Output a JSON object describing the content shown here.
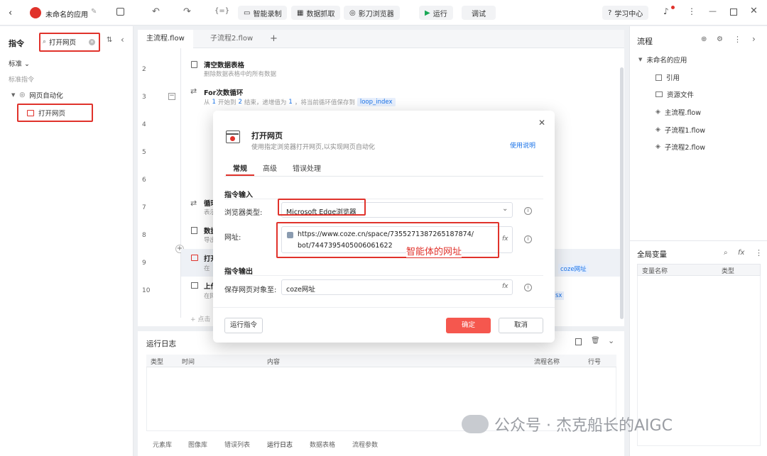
{
  "app": {
    "title": "未命名的应用"
  },
  "toolbar": {
    "smart_record": "智能录制",
    "data_capture": "数据抓取",
    "browser": "影刀浏览器",
    "run": "运行",
    "debug": "调试",
    "learn": "学习中心"
  },
  "left": {
    "title": "指令",
    "search_value": "打开网页",
    "standard": "标准",
    "standard_cmds": "标准指令",
    "group": "网页自动化",
    "item": "打开网页"
  },
  "tabs": [
    {
      "label": "主流程.flow"
    },
    {
      "label": "子流程2.flow"
    }
  ],
  "rows": {
    "r2": {
      "num": "2",
      "title": "清空数据表格",
      "desc": "删除数据表格中的所有数据"
    },
    "r3": {
      "num": "3",
      "title": "For次数循环",
      "d1": "从",
      "v1": "1",
      "d2": "开始到",
      "v2": "2",
      "d3": "结束，递增值为",
      "v3": "1",
      "d4": "，将当前循环值保存到",
      "v4": "loop_index"
    },
    "n4": "4",
    "n5": "5",
    "n6": "6",
    "r7": {
      "num": "7",
      "title": "循环",
      "desc": "表示"
    },
    "r8": {
      "num": "8",
      "title": "数据",
      "desc": "导出"
    },
    "r9": {
      "num": "9",
      "title": "打开",
      "desc": "在",
      "tail": "coze网址"
    },
    "r10": {
      "num": "10",
      "title": "上传",
      "desc": "在网",
      "tail": "sx"
    },
    "add": "点击"
  },
  "log": {
    "title": "运行日志",
    "cols": [
      "类型",
      "时间",
      "内容",
      "流程名称",
      "行号"
    ],
    "tabs": [
      "元素库",
      "图像库",
      "错误列表",
      "运行日志",
      "数据表格",
      "流程参数"
    ]
  },
  "right": {
    "title": "流程",
    "root": "未命名的应用",
    "items": [
      "引用",
      "资源文件",
      "主流程.flow",
      "子流程1.flow",
      "子流程2.flow"
    ],
    "vars_title": "全局变量",
    "var_cols": [
      "变量名称",
      "类型"
    ]
  },
  "modal": {
    "title": "打开网页",
    "desc": "使用指定浏览器打开网页,以实现网页自动化",
    "help": "使用说明",
    "tabs": [
      "常规",
      "高级",
      "错误处理"
    ],
    "input_section": "指令输入",
    "browser_label": "浏览器类型:",
    "browser_value": "Microsoft Edge浏览器",
    "url_label": "网址:",
    "url_line1": "https://www.coze.cn/space/7355271387265187874/",
    "url_line2": "bot/7447395405006061622",
    "annotation": "智能体的网址",
    "output_section": "指令输出",
    "save_label": "保存网页对象至:",
    "save_value": "coze网址",
    "run_cmd": "运行指令",
    "confirm": "确定",
    "cancel": "取消"
  },
  "watermark": "公众号 · 杰克船长的AIGC",
  "colors": {
    "accent": "#1a73e8",
    "red": "#e0322b",
    "confirm": "#f5574e"
  }
}
